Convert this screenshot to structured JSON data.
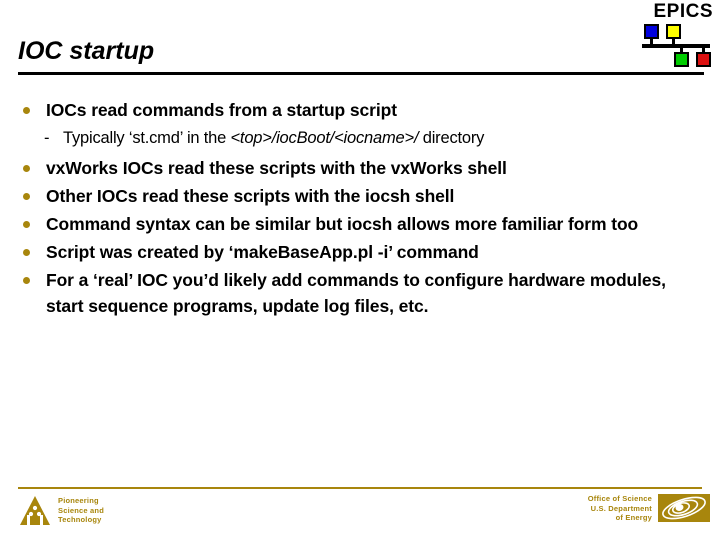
{
  "brand": {
    "epics_wordmark": "EPICS",
    "node_colors": {
      "blue": "#0000dd",
      "yellow": "#ffff00",
      "green": "#00cc00",
      "red": "#dd1111"
    }
  },
  "slide": {
    "title": "IOC startup",
    "accent_color": "#a8860d",
    "bullets": [
      {
        "text": "IOCs read commands from a startup script",
        "sub": [
          {
            "dash": "-",
            "prefix": "Typically ‘st.cmd’ in the ",
            "path": "<top>/iocBoot/<iocname>/",
            "suffix": " directory"
          }
        ]
      },
      {
        "text": "vxWorks IOCs read these scripts with the vxWorks shell",
        "sub": []
      },
      {
        "text": "Other IOCs read these scripts with the iocsh shell",
        "sub": []
      },
      {
        "text": "Command syntax can be similar but iocsh allows more familiar form too",
        "sub": []
      },
      {
        "text": "Script was created by ‘makeBaseApp.pl -i’ command",
        "sub": []
      },
      {
        "text": "For a ‘real’ IOC you’d likely add commands to configure hardware modules, start sequence programs, update log files, etc.",
        "sub": []
      }
    ]
  },
  "footer": {
    "anl_tagline_line1": "Pioneering",
    "anl_tagline_line2": "Science and",
    "anl_tagline_line3": "Technology",
    "doe_line1": "Office of Science",
    "doe_line2": "U.S. Department",
    "doe_line3": "of Energy"
  }
}
